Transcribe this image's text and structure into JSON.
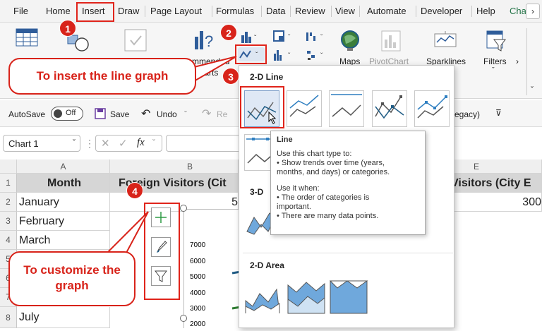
{
  "menu": [
    "File",
    "Home",
    "Insert",
    "Draw",
    "Page Layout",
    "Formulas",
    "Data",
    "Review",
    "View",
    "Automate",
    "Developer",
    "Help",
    "Char"
  ],
  "ribbon": {
    "recommended_line1": "mmended",
    "recommended_line2": "Charts",
    "maps": "Maps",
    "pivotchart": "PivotChart",
    "sparklines": "Sparklines",
    "filters": "Filters"
  },
  "qat": {
    "autosave": "AutoSave",
    "toggle": "Off",
    "save": "Save",
    "undo": "Undo",
    "redo": "Re",
    "legacy": "egacy)"
  },
  "namebox": "Chart 1",
  "fx": "fx",
  "columns": [
    "A",
    "B",
    "E"
  ],
  "rows": [
    "1",
    "2",
    "3",
    "4",
    "5",
    "6",
    "7",
    "8"
  ],
  "cells": {
    "a1": "Month",
    "b1": "Foreign Visitors (Cit",
    "e1": "Visitors (City E",
    "a2": "January",
    "b2": "5",
    "e2": "300",
    "a3": "February",
    "a4": "March",
    "a8": "July"
  },
  "chart_axis": [
    "7000",
    "6000",
    "5000",
    "4000",
    "3000",
    "2000"
  ],
  "dropdown": {
    "line2d": "2-D Line",
    "line3d": "3-D",
    "area2d": "2-D Area"
  },
  "tooltip": {
    "title": "Line",
    "use": "Use this chart type to:",
    "b1": "• Show trends over time (years,",
    "b1b": "months, and days) or categories.",
    "when": "Use it when:",
    "b2": "• The order of categories is",
    "b2b": "important.",
    "b3": "• There are many data points."
  },
  "badges": [
    "1",
    "2",
    "3",
    "4"
  ],
  "callouts": {
    "insert": "To insert the line graph",
    "customize1": "To customize the",
    "customize2": "graph"
  },
  "colors": {
    "red": "#d8231a",
    "series1": "#1f5c85",
    "series2": "#2e7d32",
    "excel_green": "#217346"
  }
}
